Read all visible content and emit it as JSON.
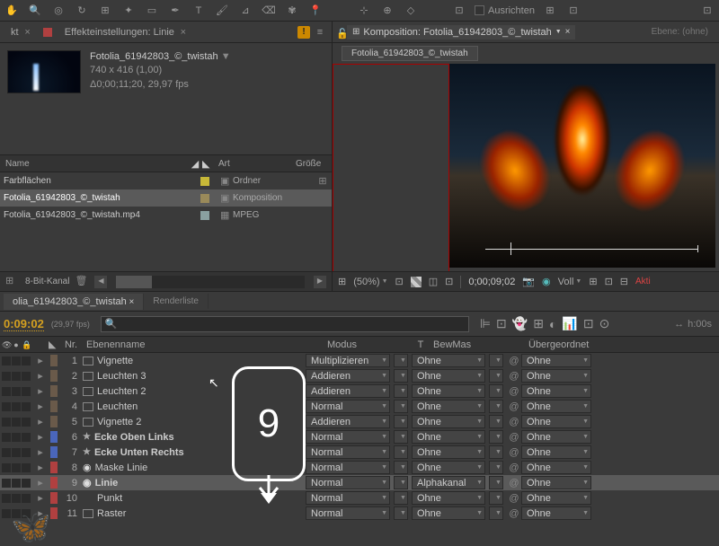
{
  "toolbar": {
    "align": "Ausrichten"
  },
  "project": {
    "tab1": "kt",
    "tab2": "Effekteinstellungen: Linie",
    "compName": "Fotolia_61942803_©_twistah",
    "dims": "740 x 416 (1,00)",
    "duration": "Δ0;00;11;20, 29,97 fps"
  },
  "browser": {
    "hName": "Name",
    "hArt": "Art",
    "hSize": "Größe",
    "rows": [
      {
        "name": "Farbflächen",
        "type": "Ordner",
        "color": "#c7b838"
      },
      {
        "name": "Fotolia_61942803_©_twistah",
        "type": "Komposition",
        "color": "#9a8a5a"
      },
      {
        "name": "Fotolia_61942803_©_twistah.mp4",
        "type": "MPEG",
        "color": "#8aa0a0"
      }
    ],
    "bpc": "8-Bit-Kanal"
  },
  "comp": {
    "panelLabel": "Komposition: Fotolia_61942803_©_twistah",
    "ebene": "Ebene: (ohne)",
    "breadcrumb": "Fotolia_61942803_©_twistah",
    "zoom": "(50%)",
    "time": "0;00;09;02",
    "view": "Voll",
    "akt": "Akti"
  },
  "timeline": {
    "tab1": "olia_61942803_©_twistah",
    "tab2": "Renderliste",
    "timecode": "0:09:02",
    "fps": "(29,97 fps)",
    "ruler0": "h:00s",
    "cols": {
      "nr": "Nr.",
      "name": "Ebenenname",
      "mode": "Modus",
      "t": "T",
      "bw": "BewMas",
      "parent": "Übergeordnet"
    },
    "layers": [
      {
        "n": "1",
        "name": "Vignette",
        "mode": "Multiplizieren",
        "bw": "Ohne",
        "parent": "Ohne",
        "c": "#6a5a4a",
        "src": true
      },
      {
        "n": "2",
        "name": "Leuchten 3",
        "mode": "Addieren",
        "bw": "Ohne",
        "parent": "Ohne",
        "c": "#6a5a4a",
        "src": true
      },
      {
        "n": "3",
        "name": "Leuchten 2",
        "mode": "Addieren",
        "bw": "Ohne",
        "parent": "Ohne",
        "c": "#6a5a4a",
        "src": true
      },
      {
        "n": "4",
        "name": "Leuchten",
        "mode": "Normal",
        "bw": "Ohne",
        "parent": "Ohne",
        "c": "#6a5a4a",
        "src": true
      },
      {
        "n": "5",
        "name": "Vignette 2",
        "mode": "Addieren",
        "bw": "Ohne",
        "parent": "Ohne",
        "c": "#6a5a4a",
        "src": true
      },
      {
        "n": "6",
        "name": "Ecke Oben Links",
        "mode": "Normal",
        "bw": "Ohne",
        "parent": "Ohne",
        "c": "#4a66bb",
        "star": true
      },
      {
        "n": "7",
        "name": "Ecke Unten Rechts",
        "mode": "Normal",
        "bw": "Ohne",
        "parent": "Ohne",
        "c": "#4a66bb",
        "star": true
      },
      {
        "n": "8",
        "name": "Maske Linie",
        "mode": "Normal",
        "bw": "Ohne",
        "parent": "Ohne",
        "c": "#b04040",
        "fx": true
      },
      {
        "n": "9",
        "name": "Linie",
        "mode": "Normal",
        "bw": "Alphakanal",
        "parent": "Ohne",
        "c": "#b04040",
        "fx": true,
        "selected": true
      },
      {
        "n": "10",
        "name": "Punkt",
        "mode": "Normal",
        "bw": "Ohne",
        "parent": "Ohne",
        "c": "#b04040"
      },
      {
        "n": "11",
        "name": "Raster",
        "mode": "Normal",
        "bw": "Ohne",
        "parent": "Ohne",
        "c": "#b04040",
        "src": true
      }
    ]
  },
  "overlay": {
    "num": "9"
  }
}
